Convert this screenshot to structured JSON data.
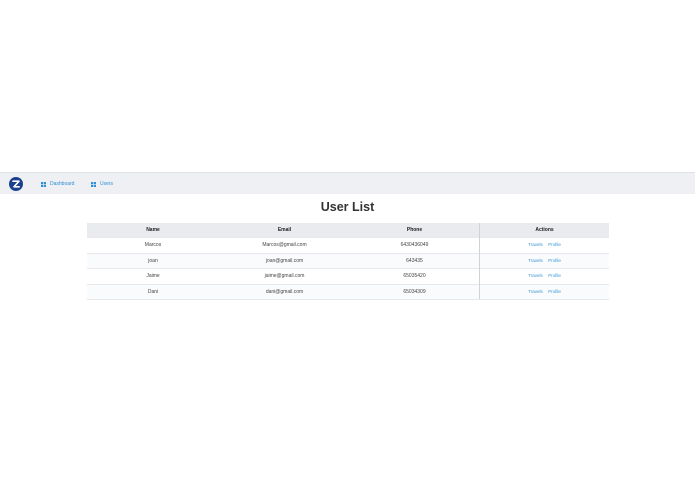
{
  "nav": {
    "items": [
      {
        "label": "Dashboard",
        "icon": "grid-icon"
      },
      {
        "label": "Users",
        "icon": "grid-icon"
      }
    ]
  },
  "page": {
    "title": "User List"
  },
  "table": {
    "headers": {
      "name": "Name",
      "email": "Email",
      "phone": "Phone",
      "actions": "Actions"
    },
    "rows": [
      {
        "name": "Marcos",
        "email": "Marcos@gmail.com",
        "phone": "6430436049",
        "action1": "Travels",
        "action2": "Profile"
      },
      {
        "name": "joan",
        "email": "joan@gmail.com",
        "phone": "643435",
        "action1": "Travels",
        "action2": "Profile"
      },
      {
        "name": "Jaime",
        "email": "jaime@gmail.com",
        "phone": "65035420",
        "action1": "Travels",
        "action2": "Profile"
      },
      {
        "name": "Dani",
        "email": "dani@gmail.com",
        "phone": "65034309",
        "action1": "Travels",
        "action2": "Profile"
      }
    ]
  },
  "colors": {
    "brand": "#1d3f8f",
    "link": "#2d8fd6",
    "navbar_bg": "#eef0f3",
    "header_bg": "#e9ebee"
  }
}
